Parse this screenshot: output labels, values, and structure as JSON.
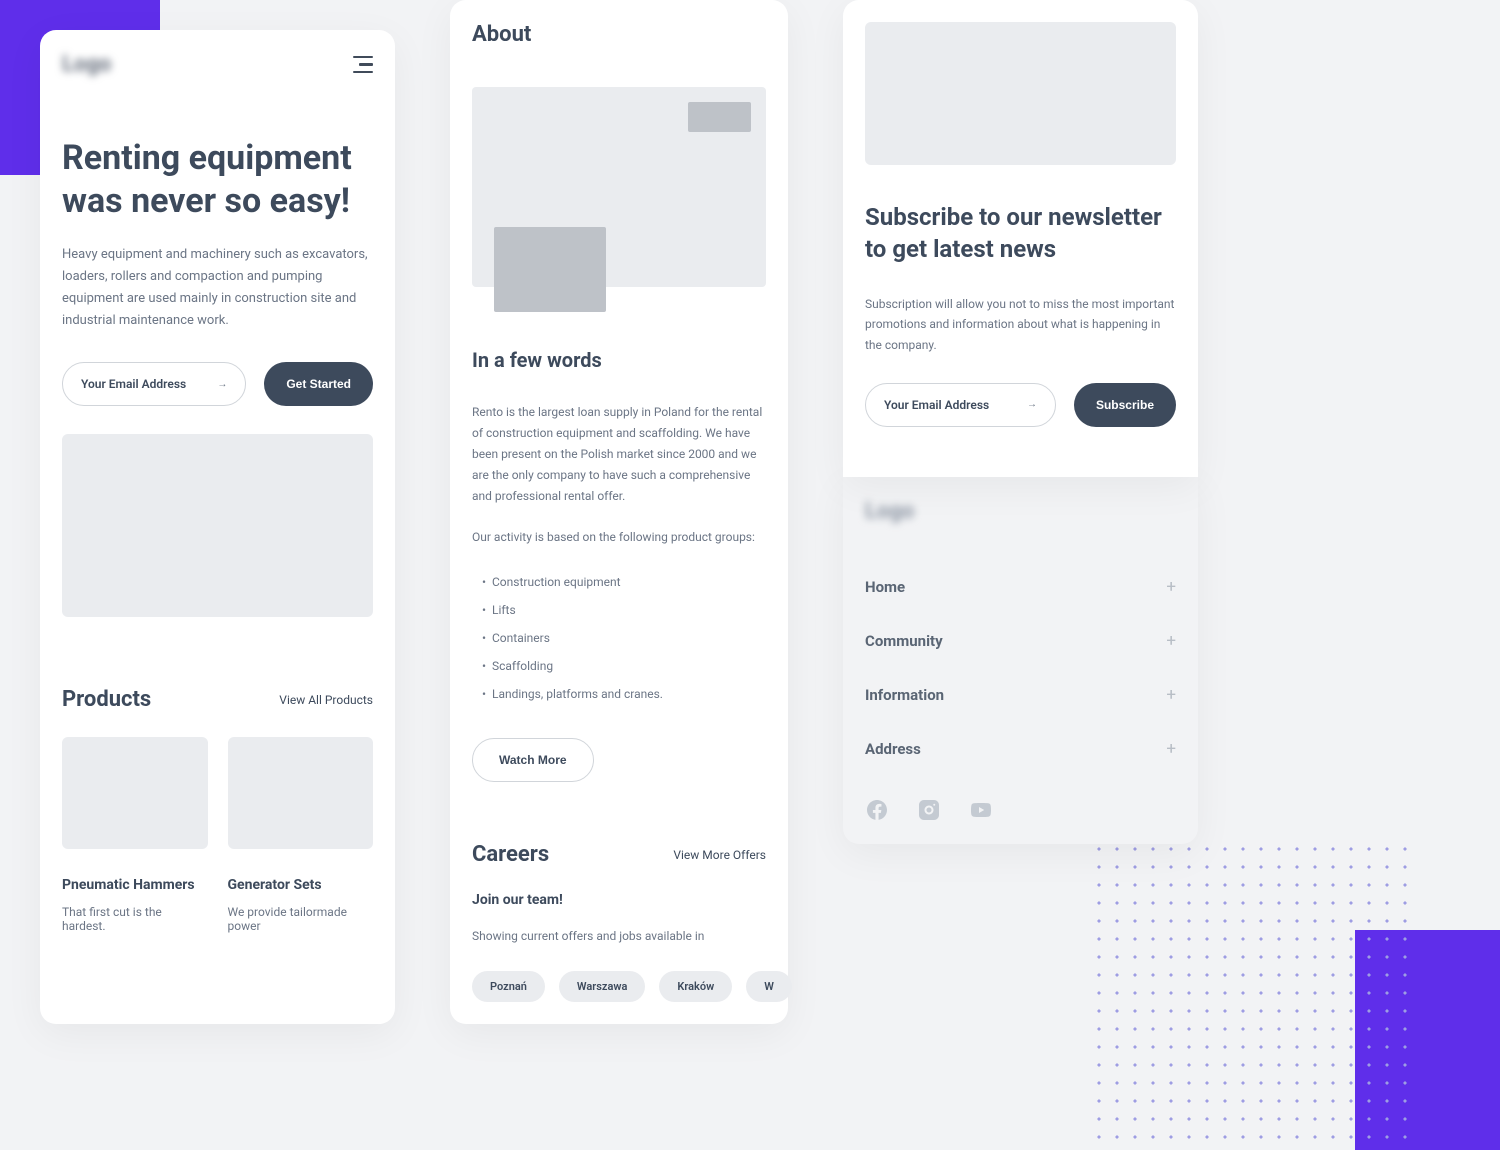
{
  "logo": "Logo",
  "hero": {
    "title": "Renting equipment was never so easy!",
    "description": "Heavy equipment and machinery such as excavators, loaders, rollers and compaction and pumping equipment are used mainly in construction site and industrial maintenance work.",
    "email_placeholder": "Your Email Address",
    "cta": "Get Started"
  },
  "products": {
    "title": "Products",
    "view_all": "View All Products",
    "items": [
      {
        "title": "Pneumatic Hammers",
        "desc": "That first cut is the hardest."
      },
      {
        "title": "Generator Sets",
        "desc": "We provide tailormade power"
      }
    ]
  },
  "about": {
    "title": "About",
    "subheading": "In a few words",
    "text1": "Rento is the largest loan supply in Poland for the rental of construction equipment and scaffolding. We have been present on the Polish market since 2000 and we are the only company to have such a comprehensive and professional rental offer.",
    "text2": "Our activity is based on the following product groups:",
    "list": [
      "Construction equipment",
      "Lifts",
      "Containers",
      "Scaffolding",
      "Landings, platforms and cranes."
    ],
    "watch_more": "Watch More"
  },
  "careers": {
    "title": "Careers",
    "view_more": "View More Offers",
    "subtitle": "Join our team!",
    "text": "Showing current offers and jobs available in",
    "chips": [
      "Poznań",
      "Warszawa",
      "Kraków",
      "W"
    ]
  },
  "newsletter": {
    "title": "Subscribe to our newsletter to get latest news",
    "desc": "Subscription will allow you not to miss the most important promotions and information about what is happening in the company.",
    "email_placeholder": "Your Email Address",
    "cta": "Subscribe"
  },
  "footer": {
    "logo": "Logo",
    "items": [
      "Home",
      "Community",
      "Information",
      "Address"
    ]
  }
}
